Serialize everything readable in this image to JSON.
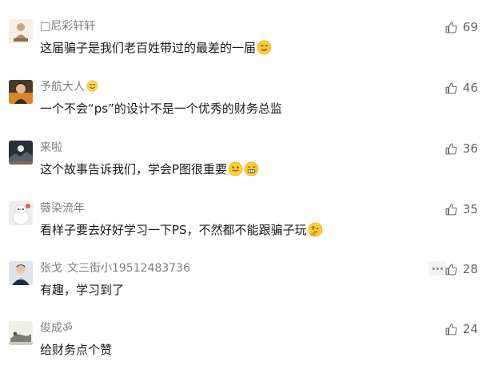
{
  "colors": {
    "name_text": "#7d7d7d",
    "comment_text": "#1a1a1a",
    "like_text": "#666666"
  },
  "comments": [
    {
      "name": "□尼彩轩轩",
      "name_suffix": "",
      "text": "这届骗子是我们老百姓带过的最差的一届",
      "emoji": [
        "smirk-emoji"
      ],
      "likes": "69",
      "avatar_icon": "figure-avatar"
    },
    {
      "name": "予航大人",
      "name_suffix": "",
      "name_emoji": "smile-emoji",
      "text": "一个不会“ps”的设计不是一个优秀的财务总监",
      "emoji": [],
      "likes": "46",
      "avatar_icon": "person-avatar"
    },
    {
      "name": "来啦",
      "name_suffix": "",
      "text": "这个故事告诉我们，学会P图很重要",
      "emoji": [
        "tongue-emoji",
        "grimace-emoji"
      ],
      "likes": "36",
      "avatar_icon": "night-scene-avatar"
    },
    {
      "name": "薇染流年",
      "name_suffix": "",
      "text": "看样子要去好好学习一下PS，不然都不能跟骗子玩",
      "emoji": [
        "thinking-emoji"
      ],
      "likes": "35",
      "avatar_icon": "baymax-avatar"
    },
    {
      "name": "张戈",
      "name_suffix": "文三街小19512483736",
      "text": "有趣，学习到了",
      "emoji": [],
      "likes": "28",
      "avatar_icon": "suit-person-avatar",
      "show_more": true
    },
    {
      "name": "俊成ॐ",
      "name_suffix": "",
      "text": "给财务点个赞",
      "emoji": [],
      "likes": "24",
      "avatar_icon": "reclining-figure-avatar"
    }
  ]
}
